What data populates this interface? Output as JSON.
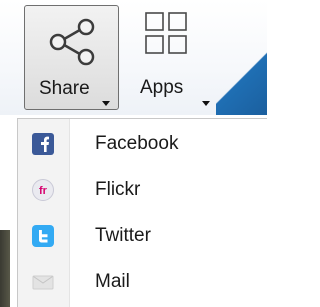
{
  "ribbon": {
    "share": {
      "label": "Share",
      "icon": "share-icon"
    },
    "apps": {
      "label": "Apps",
      "icon": "apps-grid-icon"
    },
    "accent_color": "#1f6fb4"
  },
  "menu": {
    "items": [
      {
        "label": "Facebook",
        "icon": "facebook-icon",
        "color": "#3b5998"
      },
      {
        "label": "Flickr",
        "icon": "flickr-icon",
        "color": "#ff0084"
      },
      {
        "label": "Twitter",
        "icon": "twitter-icon",
        "color": "#33aaf3"
      },
      {
        "label": "Mail",
        "icon": "mail-icon",
        "color": "#d6d6d6"
      }
    ]
  }
}
